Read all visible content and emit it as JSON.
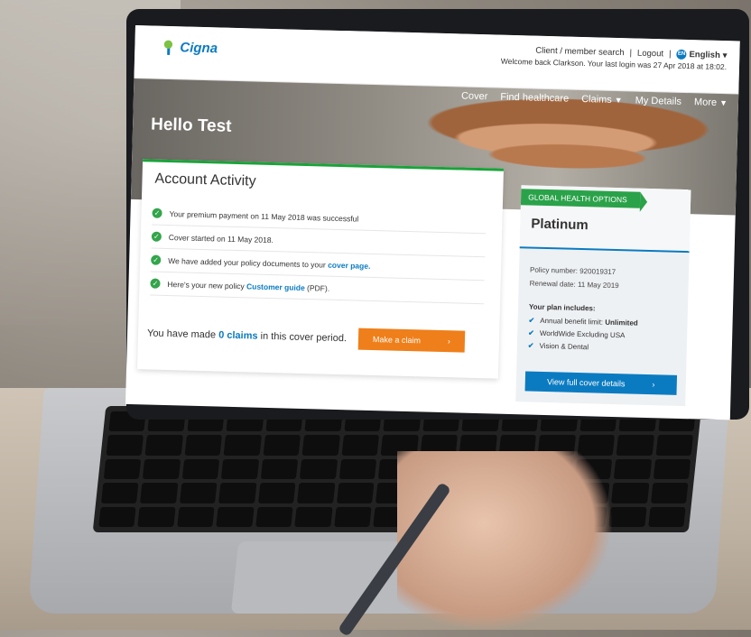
{
  "header": {
    "logo_text": "Cigna",
    "client_search": "Client / member search",
    "separator": "|",
    "logout": "Logout",
    "language_badge": "EN",
    "language": "English",
    "welcome": "Welcome back  Clarkson.  Your last login was 27 Apr 2018 at 18:02."
  },
  "nav": {
    "items": [
      "Cover",
      "Find healthcare",
      "Claims",
      "My Details",
      "More"
    ]
  },
  "hero": {
    "greeting": "Hello Test"
  },
  "activity": {
    "title": "Account Activity",
    "rows": [
      {
        "text": "Your premium payment on 11 May 2018 was successful",
        "link": "",
        "suffix": ""
      },
      {
        "text": "Cover started on 11 May 2018.",
        "link": "",
        "suffix": ""
      },
      {
        "text": "We have added your policy documents to your ",
        "link": "cover page.",
        "suffix": ""
      },
      {
        "text": "Here's your new policy ",
        "link": "Customer guide",
        "suffix": " (PDF)."
      }
    ],
    "claims_prefix": "You have made ",
    "claims_count": "0 claims",
    "claims_suffix": " in this cover period.",
    "make_claim": "Make a claim",
    "arrow": "›"
  },
  "plan": {
    "tag": "GLOBAL HEALTH OPTIONS",
    "name": "Platinum",
    "policy_number": "Policy number: 920019317",
    "renewal_date": "Renewal date: 11 May 2019",
    "includes_title": "Your plan includes:",
    "limit_prefix": "Annual benefit limit: ",
    "limit_value": "Unlimited",
    "coverage": "WorldWide Excluding USA",
    "extras": "Vision & Dental",
    "view_button": "View full cover details",
    "arrow": "›"
  },
  "icons": {
    "check": "check-circle-icon",
    "tick": "checkmark-icon",
    "chevron": "chevron-down-icon"
  },
  "colors": {
    "brand_blue": "#0b7bc1",
    "green": "#2aa249",
    "orange": "#ef7f1a"
  }
}
